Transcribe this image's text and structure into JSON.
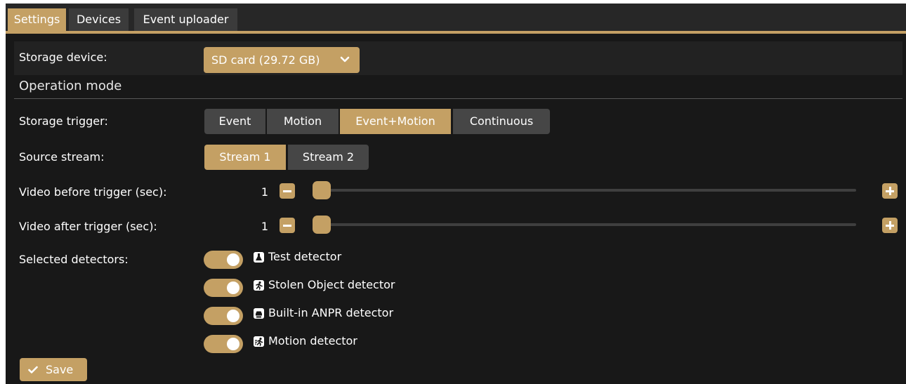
{
  "tabs": [
    {
      "label": "Settings",
      "active": true
    },
    {
      "label": "Devices",
      "active": false
    },
    {
      "label": "Event uploader",
      "active": false
    }
  ],
  "storage": {
    "label": "Storage device:",
    "selected": "SD card (29.72 GB)",
    "icon": "chevron-down-icon"
  },
  "operation_mode": {
    "title": "Operation mode"
  },
  "storage_trigger": {
    "label": "Storage trigger:",
    "options": [
      "Event",
      "Motion",
      "Event+Motion",
      "Continuous"
    ],
    "selected": "Event+Motion"
  },
  "source_stream": {
    "label": "Source stream:",
    "options": [
      "Stream 1",
      "Stream 2"
    ],
    "selected": "Stream 1"
  },
  "video_before": {
    "label": "Video before trigger (sec):",
    "value": "1",
    "slider_fraction": 0
  },
  "video_after": {
    "label": "Video after trigger (sec):",
    "value": "1",
    "slider_fraction": 0
  },
  "detectors": {
    "label": "Selected detectors:",
    "items": [
      {
        "name": "Test detector",
        "enabled": true,
        "icon": "flask-icon"
      },
      {
        "name": "Stolen Object detector",
        "enabled": true,
        "icon": "running-person-icon"
      },
      {
        "name": "Built-in ANPR detector",
        "enabled": true,
        "icon": "car-plate-icon"
      },
      {
        "name": "Motion detector",
        "enabled": true,
        "icon": "motion-icon"
      }
    ]
  },
  "save": {
    "label": "Save",
    "icon": "check-icon"
  },
  "colors": {
    "accent": "#c4a064",
    "background": "#181818",
    "inactive_button": "#464646",
    "tab_inactive": "#3b3b3b"
  }
}
